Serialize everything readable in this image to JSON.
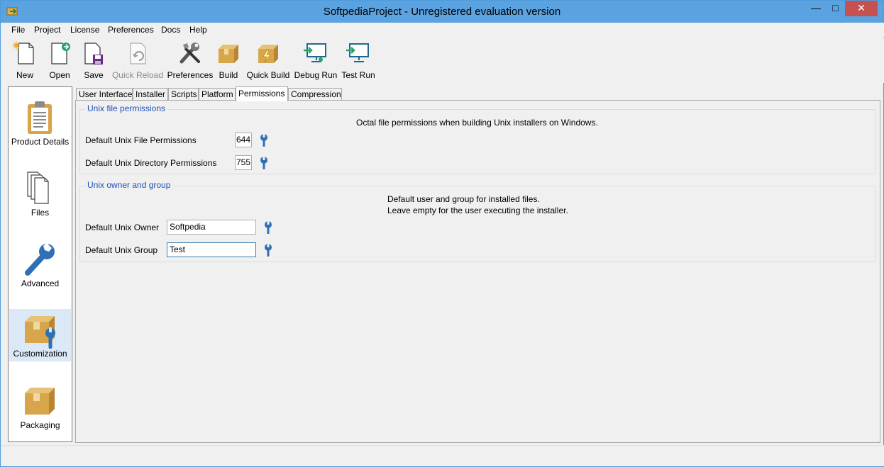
{
  "window": {
    "title": "SoftpediaProject - Unregistered evaluation version",
    "accent": "#5aa2e0"
  },
  "menu": [
    "File",
    "Project",
    "License",
    "Preferences",
    "Docs",
    "Help"
  ],
  "toolbar": {
    "new": "New",
    "open": "Open",
    "save": "Save",
    "quick_reload": "Quick Reload",
    "preferences": "Preferences",
    "build": "Build",
    "quick_build": "Quick Build",
    "debug_run": "Debug Run",
    "test_run": "Test Run"
  },
  "sidebar": {
    "items": [
      {
        "label": "Product Details",
        "icon": "clipboard-icon"
      },
      {
        "label": "Files",
        "icon": "files-icon"
      },
      {
        "label": "Advanced",
        "icon": "wrench-icon"
      },
      {
        "label": "Customization",
        "icon": "box-wrench-icon",
        "active": true
      },
      {
        "label": "Packaging",
        "icon": "box-icon"
      }
    ]
  },
  "tabs": [
    "User Interface",
    "Installer",
    "Scripts",
    "Platform",
    "Permissions",
    "Compression"
  ],
  "active_tab": "Permissions",
  "unix_permissions": {
    "group_title": "Unix file permissions",
    "description": "Octal file permissions when building Unix installers on Windows.",
    "file_label": "Default Unix File Permissions",
    "file_value": "644",
    "dir_label": "Default Unix Directory Permissions",
    "dir_value": "755"
  },
  "unix_owner": {
    "group_title": "Unix owner and group",
    "description_line1": "Default user and group for installed files.",
    "description_line2": "Leave empty for the user executing the installer.",
    "owner_label": "Default Unix Owner",
    "owner_value": "Softpedia",
    "group_label": "Default Unix Group",
    "group_value": "Test"
  }
}
